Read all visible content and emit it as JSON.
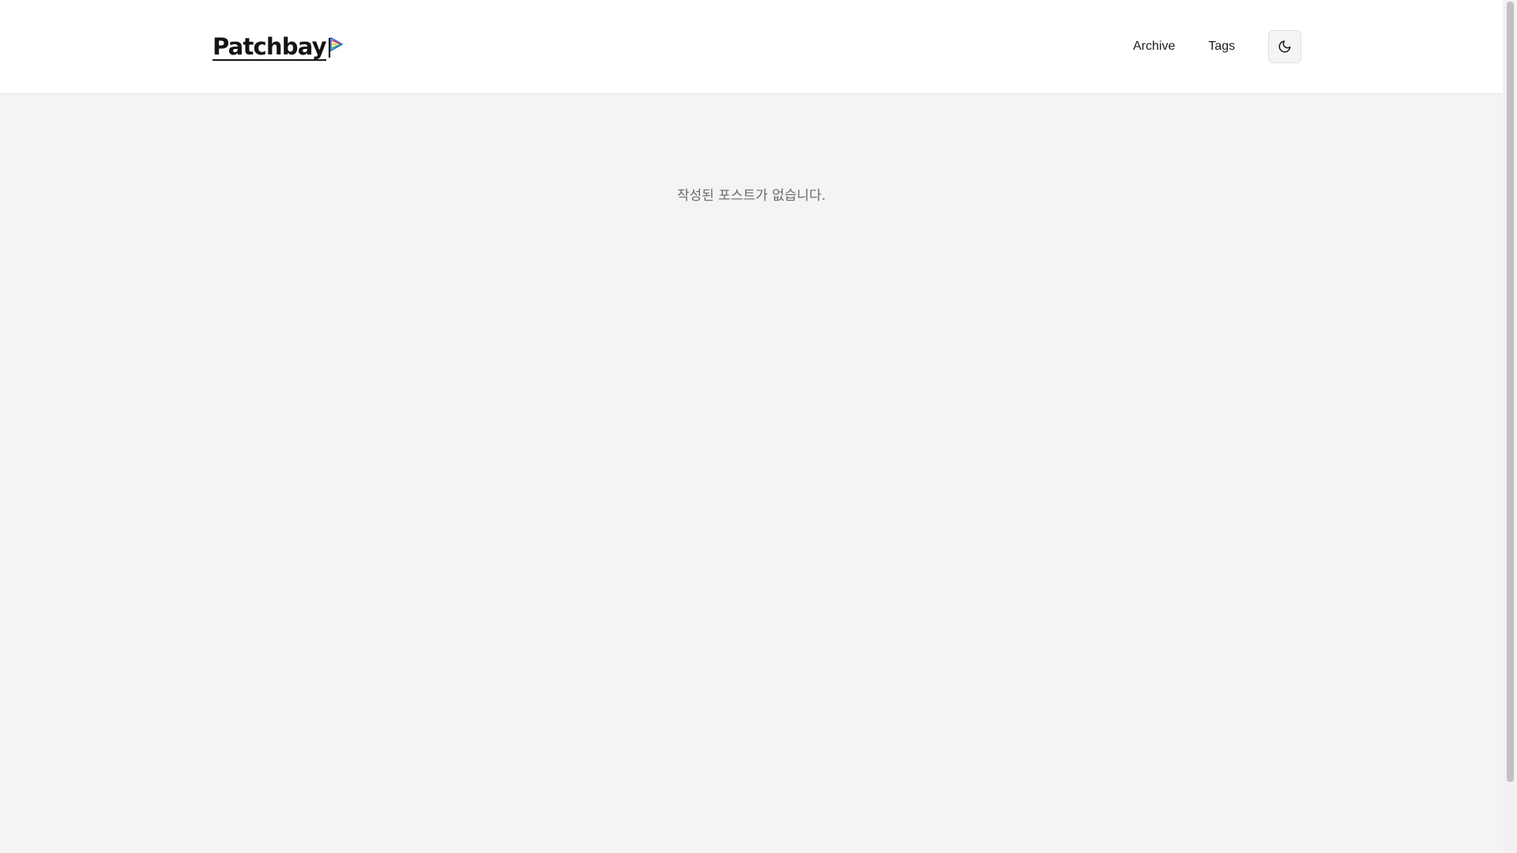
{
  "header": {
    "logo_text": "Patchbay",
    "nav": [
      {
        "label": "Archive"
      },
      {
        "label": "Tags"
      }
    ],
    "theme_toggle_icon": "moon-icon"
  },
  "main": {
    "empty_message": "작성된 포스트가 없습니다."
  },
  "colors": {
    "background": "#f4f4f4",
    "header_background": "#ffffff",
    "text": "#141414",
    "muted_text": "#6a6a6a",
    "logo_accent_blue": "#2b6fe0",
    "logo_accent_red": "#e0344a",
    "logo_accent_green": "#2aa84a",
    "logo_accent_yellow": "#f2b01e"
  }
}
